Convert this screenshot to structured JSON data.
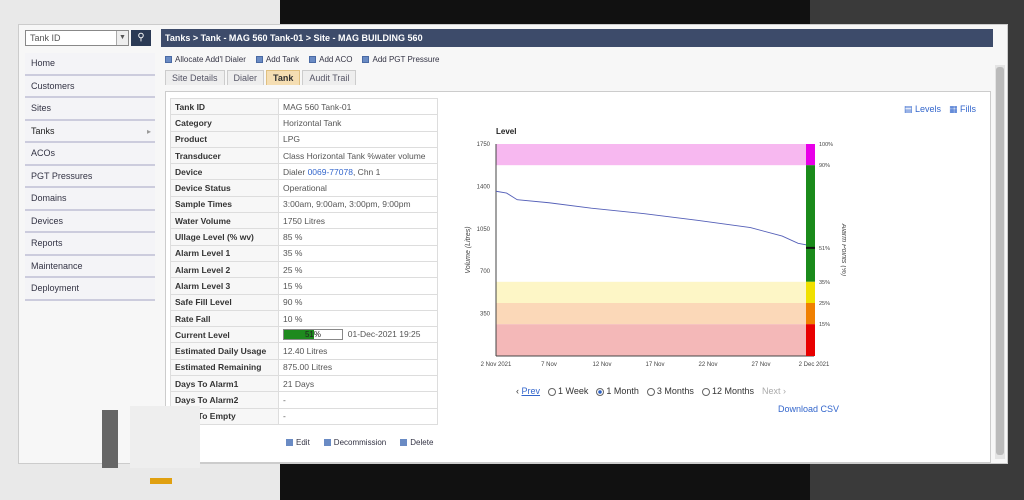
{
  "search": {
    "placeholder": "Tank ID"
  },
  "sidebar": {
    "items": [
      {
        "label": "Home"
      },
      {
        "label": "Customers"
      },
      {
        "label": "Sites"
      },
      {
        "label": "Tanks",
        "active": true
      },
      {
        "label": "ACOs"
      },
      {
        "label": "PGT Pressures"
      },
      {
        "label": "Domains"
      },
      {
        "label": "Devices"
      },
      {
        "label": "Reports"
      },
      {
        "label": "Maintenance"
      },
      {
        "label": "Deployment"
      }
    ]
  },
  "breadcrumb": "Tanks > Tank - MAG 560 Tank-01 > Site - MAG BUILDING 560",
  "toolbar": {
    "allocate": "Allocate Add'l Dialer",
    "add_tank": "Add Tank",
    "add_aco": "Add ACO",
    "add_pgt": "Add PGT Pressure"
  },
  "tabs": [
    "Site Details",
    "Dialer",
    "Tank",
    "Audit Trail"
  ],
  "info": {
    "tank_id": {
      "k": "Tank ID",
      "v": "MAG 560 Tank-01"
    },
    "category": {
      "k": "Category",
      "v": "Horizontal Tank"
    },
    "product": {
      "k": "Product",
      "v": "LPG"
    },
    "transducer": {
      "k": "Transducer",
      "v": "Class Horizontal Tank %water volume"
    },
    "device": {
      "k": "Device",
      "pre": "Dialer ",
      "link": "0069-77078",
      "post": ", Chn 1"
    },
    "device_status": {
      "k": "Device Status",
      "v": "Operational"
    },
    "sample_times": {
      "k": "Sample Times",
      "v": "3:00am, 9:00am, 3:00pm, 9:00pm"
    },
    "water_volume": {
      "k": "Water Volume",
      "v": "1750 Litres"
    },
    "ullage": {
      "k": "Ullage Level (% wv)",
      "v": "85 %"
    },
    "alarm1": {
      "k": "Alarm Level 1",
      "v": "35 %"
    },
    "alarm2": {
      "k": "Alarm Level 2",
      "v": "25 %"
    },
    "alarm3": {
      "k": "Alarm Level 3",
      "v": "15 %"
    },
    "safe_fill": {
      "k": "Safe Fill Level",
      "v": "90 %"
    },
    "rate_fall": {
      "k": "Rate Fall",
      "v": "10 %"
    },
    "current_level": {
      "k": "Current Level",
      "v": "51%",
      "fraction": 0.51,
      "date": "01-Dec-2021 19:25"
    },
    "est_daily": {
      "k": "Estimated Daily Usage",
      "v": "12.40 Litres"
    },
    "est_remaining": {
      "k": "Estimated Remaining",
      "v": "875.00 Litres"
    },
    "days_alarm1": {
      "k": "Days To Alarm1",
      "v": "21 Days"
    },
    "days_alarm2": {
      "k": "Days To Alarm2",
      "v": "-"
    },
    "days_empty": {
      "k": "Days To Empty",
      "v": "-"
    }
  },
  "actions": {
    "edit": "Edit",
    "decommission": "Decommission",
    "delete": "Delete"
  },
  "view_links": {
    "levels": "Levels",
    "fills": "Fills"
  },
  "range": {
    "prev": "Prev",
    "next": "Next",
    "week": "1 Week",
    "month": "1 Month",
    "three": "3 Months",
    "twelve": "12 Months",
    "selected": "1 Month"
  },
  "download_csv": "Download CSV",
  "chart_data": {
    "type": "line",
    "title": "Level",
    "ylabel": "Volume (Litres)",
    "y2label": "Alarm Points (%)",
    "ylim": [
      0,
      1750
    ],
    "yticks": [
      350,
      700,
      1050,
      1400,
      1750
    ],
    "xticks": [
      "2 Nov 2021",
      "7 Nov",
      "12 Nov",
      "17 Nov",
      "22 Nov",
      "27 Nov",
      "2 Dec 2021"
    ],
    "xlim_days": [
      0,
      30
    ],
    "series": [
      {
        "x": [
          0,
          1,
          2,
          5,
          9,
          14,
          19,
          24,
          27,
          28.5,
          30
        ],
        "y": [
          1360,
          1345,
          1290,
          1265,
          1220,
          1175,
          1120,
          1060,
          990,
          930,
          905
        ]
      }
    ],
    "bands": [
      {
        "from": 1575,
        "to": 1750,
        "color": "#f7b8f0"
      },
      {
        "from": 437.5,
        "to": 612.5,
        "color": "#fdf6c6"
      },
      {
        "from": 262.5,
        "to": 437.5,
        "color": "#fbd8b8"
      },
      {
        "from": 0,
        "to": 262.5,
        "color": "#f4b8b8"
      }
    ],
    "right_bar": [
      {
        "from": 90,
        "to": 100,
        "color": "#e800e8"
      },
      {
        "from": 35,
        "to": 90,
        "color": "#1a8a1a"
      },
      {
        "from": 25,
        "to": 35,
        "color": "#f0e000"
      },
      {
        "from": 15,
        "to": 25,
        "color": "#f08000"
      },
      {
        "from": 0,
        "to": 15,
        "color": "#e80000"
      }
    ],
    "right_ticks": [
      {
        "v": 100,
        "label": "100%"
      },
      {
        "v": 90,
        "label": "90%"
      },
      {
        "v": 51,
        "label": "51%"
      },
      {
        "v": 35,
        "label": "35%"
      },
      {
        "v": 25,
        "label": "25%"
      },
      {
        "v": 15,
        "label": "15%"
      }
    ]
  }
}
